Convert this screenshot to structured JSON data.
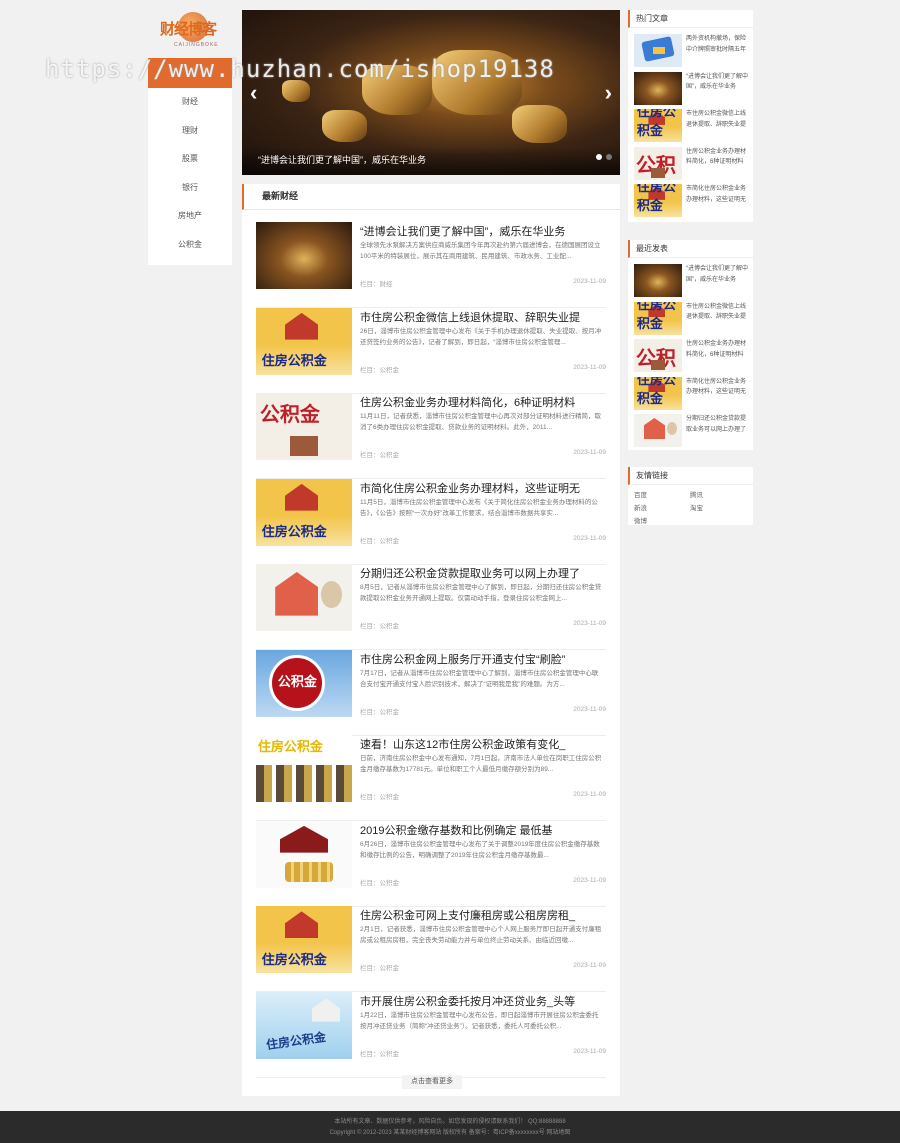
{
  "watermark": "https://www.huzhan.com/ishop19138",
  "logo": {
    "text": "财经博客",
    "sub": "CAIJINGBOKE"
  },
  "nav": [
    "财经",
    "理财",
    "股票",
    "银行",
    "房地产",
    "公积金"
  ],
  "slider": {
    "caption": "“进博会让我们更了解中国”，威乐在华业务",
    "prev": "‹",
    "next": "›"
  },
  "main": {
    "heading": "最新财经",
    "more_label": "点击查看更多",
    "articles": [
      {
        "title": "“进博会让我们更了解中国”，威乐在华业务",
        "desc": "全球领先水泵解决方案供应商威乐集团今年再次赴约第六届进博会，在德国展团设立100平米的特装展位，展示其在商用建筑、民用建筑、市政水务、工业配...",
        "meta": "栏目：财经",
        "date": "2023-11-09",
        "thumb": "gold"
      },
      {
        "title": "市住房公积金微信上线退休提取、辞职失业提",
        "desc": "26日，淄博市住房公积金管理中心发布《关于手机办理退休提取、失业提取、按月冲还贷签约业务的公告》，记者了解到，即日起，“淄博市住房公积金管理...",
        "meta": "栏目：公积金",
        "date": "2023-11-09",
        "thumb": "house"
      },
      {
        "title": "住房公积金业务办理材料简化，6种证明材料",
        "desc": "11月11日，记者获悉，淄博市住房公积金管理中心再次对部分证明材料进行精简，取消了6类办理住房公积金提取、贷款业务的证明材料。此外，2011...",
        "meta": "栏目：公积金",
        "date": "2023-11-09",
        "thumb": "gjj"
      },
      {
        "title": "市简化住房公积金业务办理材料，这些证明无",
        "desc": "11月5日，淄博市住房公积金管理中心发布《关于简化住房公积金业务办理材料的公告》，《公告》按照“一次办好”改革工作要求，结合淄博市数据共享实...",
        "meta": "栏目：公积金",
        "date": "2023-11-09",
        "thumb": "house"
      },
      {
        "title": "分期归还公积金贷款提取业务可以网上办理了",
        "desc": "8月5日，记者从淄博市住房公积金管理中心了解到，即日起，分期归还住房公积金贷款提取公积金业务开通网上提取。仅需动动手指，登录住房公积金网上...",
        "meta": "栏目：公积金",
        "date": "2023-11-09",
        "thumb": "cartoon"
      },
      {
        "title": "市住房公积金网上服务厅开通支付宝“刷脸”",
        "desc": "7月17日，记者从淄博市住房公积金管理中心了解到，淄博市住房公积金管理中心联合支付宝开通支付宝人脸识别技术，解决了“证明我是我”的难题。为方...",
        "meta": "栏目：公积金",
        "date": "2023-11-09",
        "thumb": "sign"
      },
      {
        "title": "速看！山东这12市住房公积金政策有变化_",
        "desc": "日前，济南住房公积金中心发布通知，7月1日起，济南市法人单位在岗职工住房公积金月缴存基数为17781元。单位和职工个人最低月缴存额分别为89...",
        "meta": "栏目：公积金",
        "date": "2023-11-09",
        "thumb": "coins"
      },
      {
        "title": "2019公积金缴存基数和比例确定 最低基",
        "desc": "6月26日，淄博市住房公积金管理中心发布了关于调整2019年度住房公积金缴存基数和缴存比例的公告，明确调整了2019年住房公积金月缴存基数最...",
        "meta": "栏目：公积金",
        "date": "2023-11-09",
        "thumb": "model"
      },
      {
        "title": "住房公积金可网上支付廉租房或公租房房租_",
        "desc": "2月1日，记者获悉，淄博市住房公积金管理中心个人网上服务厅即日起开通支付廉租房或公租房房租，完全丧失劳动能力并与单位终止劳动关系、由临近回缴...",
        "meta": "栏目：公积金",
        "date": "2023-11-09",
        "thumb": "house"
      },
      {
        "title": "市开展住房公积金委托按月冲还贷业务_头等",
        "desc": "1月22日，淄博市住房公积金管理中心发布公告，即日起淄博市开展住房公积金委托按月冲还贷业务（简称“冲还贷业务”）。记者获悉，委托人可委托公积...",
        "meta": "栏目：公积金",
        "date": "2023-11-09",
        "thumb": "blue"
      }
    ]
  },
  "sidebar": {
    "hot": {
      "heading": "热门文章",
      "items": [
        {
          "text": "两外资机构撤场，保险中介牌照审批时隔五年",
          "thumb": "card"
        },
        {
          "text": "“进博会让我们更了解中国”，威乐在华业务",
          "thumb": "gold"
        },
        {
          "text": "市住房公积金微信上线退休提取、辞职失业提",
          "thumb": "house"
        },
        {
          "text": "住房公积金业务办理材料简化，6种证明材料",
          "thumb": "gjj"
        },
        {
          "text": "市简化住房公积金业务办理材料，这些证明无",
          "thumb": "house"
        }
      ]
    },
    "recent": {
      "heading": "最近发表",
      "items": [
        {
          "text": "“进博会让我们更了解中国”，威乐在华业务",
          "thumb": "gold"
        },
        {
          "text": "市住房公积金微信上线退休提取、辞职失业提",
          "thumb": "house"
        },
        {
          "text": "住房公积金业务办理材料简化，6种证明材料",
          "thumb": "gjj"
        },
        {
          "text": "市简化住房公积金业务办理材料，这些证明无",
          "thumb": "house"
        },
        {
          "text": "分期归还公积金贷款提取业务可以网上办理了",
          "thumb": "cartoon"
        }
      ]
    },
    "links": {
      "heading": "友情链接",
      "items": [
        "百度",
        "腾讯",
        "新浪",
        "淘宝",
        "微博"
      ]
    }
  },
  "footer": {
    "line1": "本站所有文章、数据仅供参考，风险自负。如您发现的侵权请联系我们！ QQ:88888888",
    "line2": "Copyright © 2012-2023 某某财经博客网站 版权所有 备案号：粤ICP备xxxxxxxx号    网站地图"
  },
  "colors": {
    "accent": "#e26a2c",
    "footer_bg": "#2b2b2b"
  }
}
